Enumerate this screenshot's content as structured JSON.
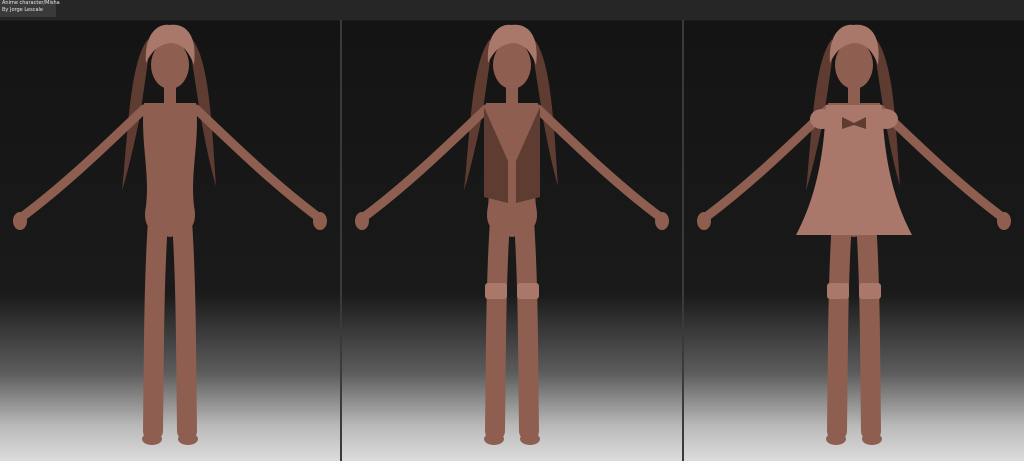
{
  "caption": {
    "line1": "Anime character/Misha",
    "line2": "By Jorge Lescale"
  },
  "panels": [
    {
      "outfit": "none"
    },
    {
      "outfit": "swimsuit-vest-boots"
    },
    {
      "outfit": "dress-bow-boots"
    }
  ],
  "colors": {
    "background": "#1b1b1b",
    "clay": "#8e5f50",
    "clay_shadow": "#5e3c31",
    "clay_highlight": "#a9786a",
    "divider": "#3a3a3a"
  }
}
